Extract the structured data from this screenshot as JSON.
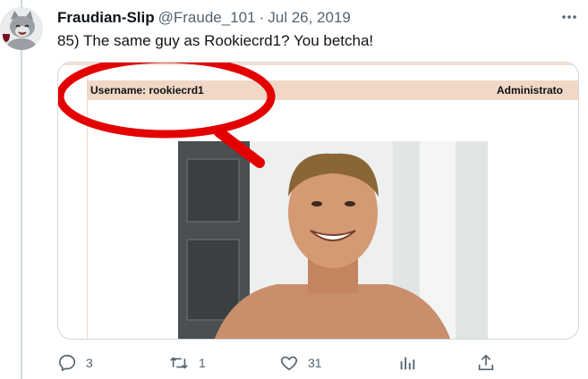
{
  "tweet": {
    "display_name": "Fraudian-Slip",
    "handle": "@Fraude_101",
    "separator": "·",
    "date": "Jul 26, 2019",
    "text": "85) The same guy as Rookiecrd1? You betcha!"
  },
  "media": {
    "document": {
      "username_label": "Username: rookiecrd1",
      "role_label": "Administrato"
    },
    "highlight_color": "#e30000",
    "header_bar_color": "#f0d7c6"
  },
  "actions": {
    "replies": "3",
    "retweets": "1",
    "likes": "31"
  },
  "icons": {
    "reply": "reply-icon",
    "retweet": "retweet-icon",
    "like": "heart-icon",
    "views": "analytics-icon",
    "share": "share-icon",
    "more": "more-dots-icon"
  }
}
